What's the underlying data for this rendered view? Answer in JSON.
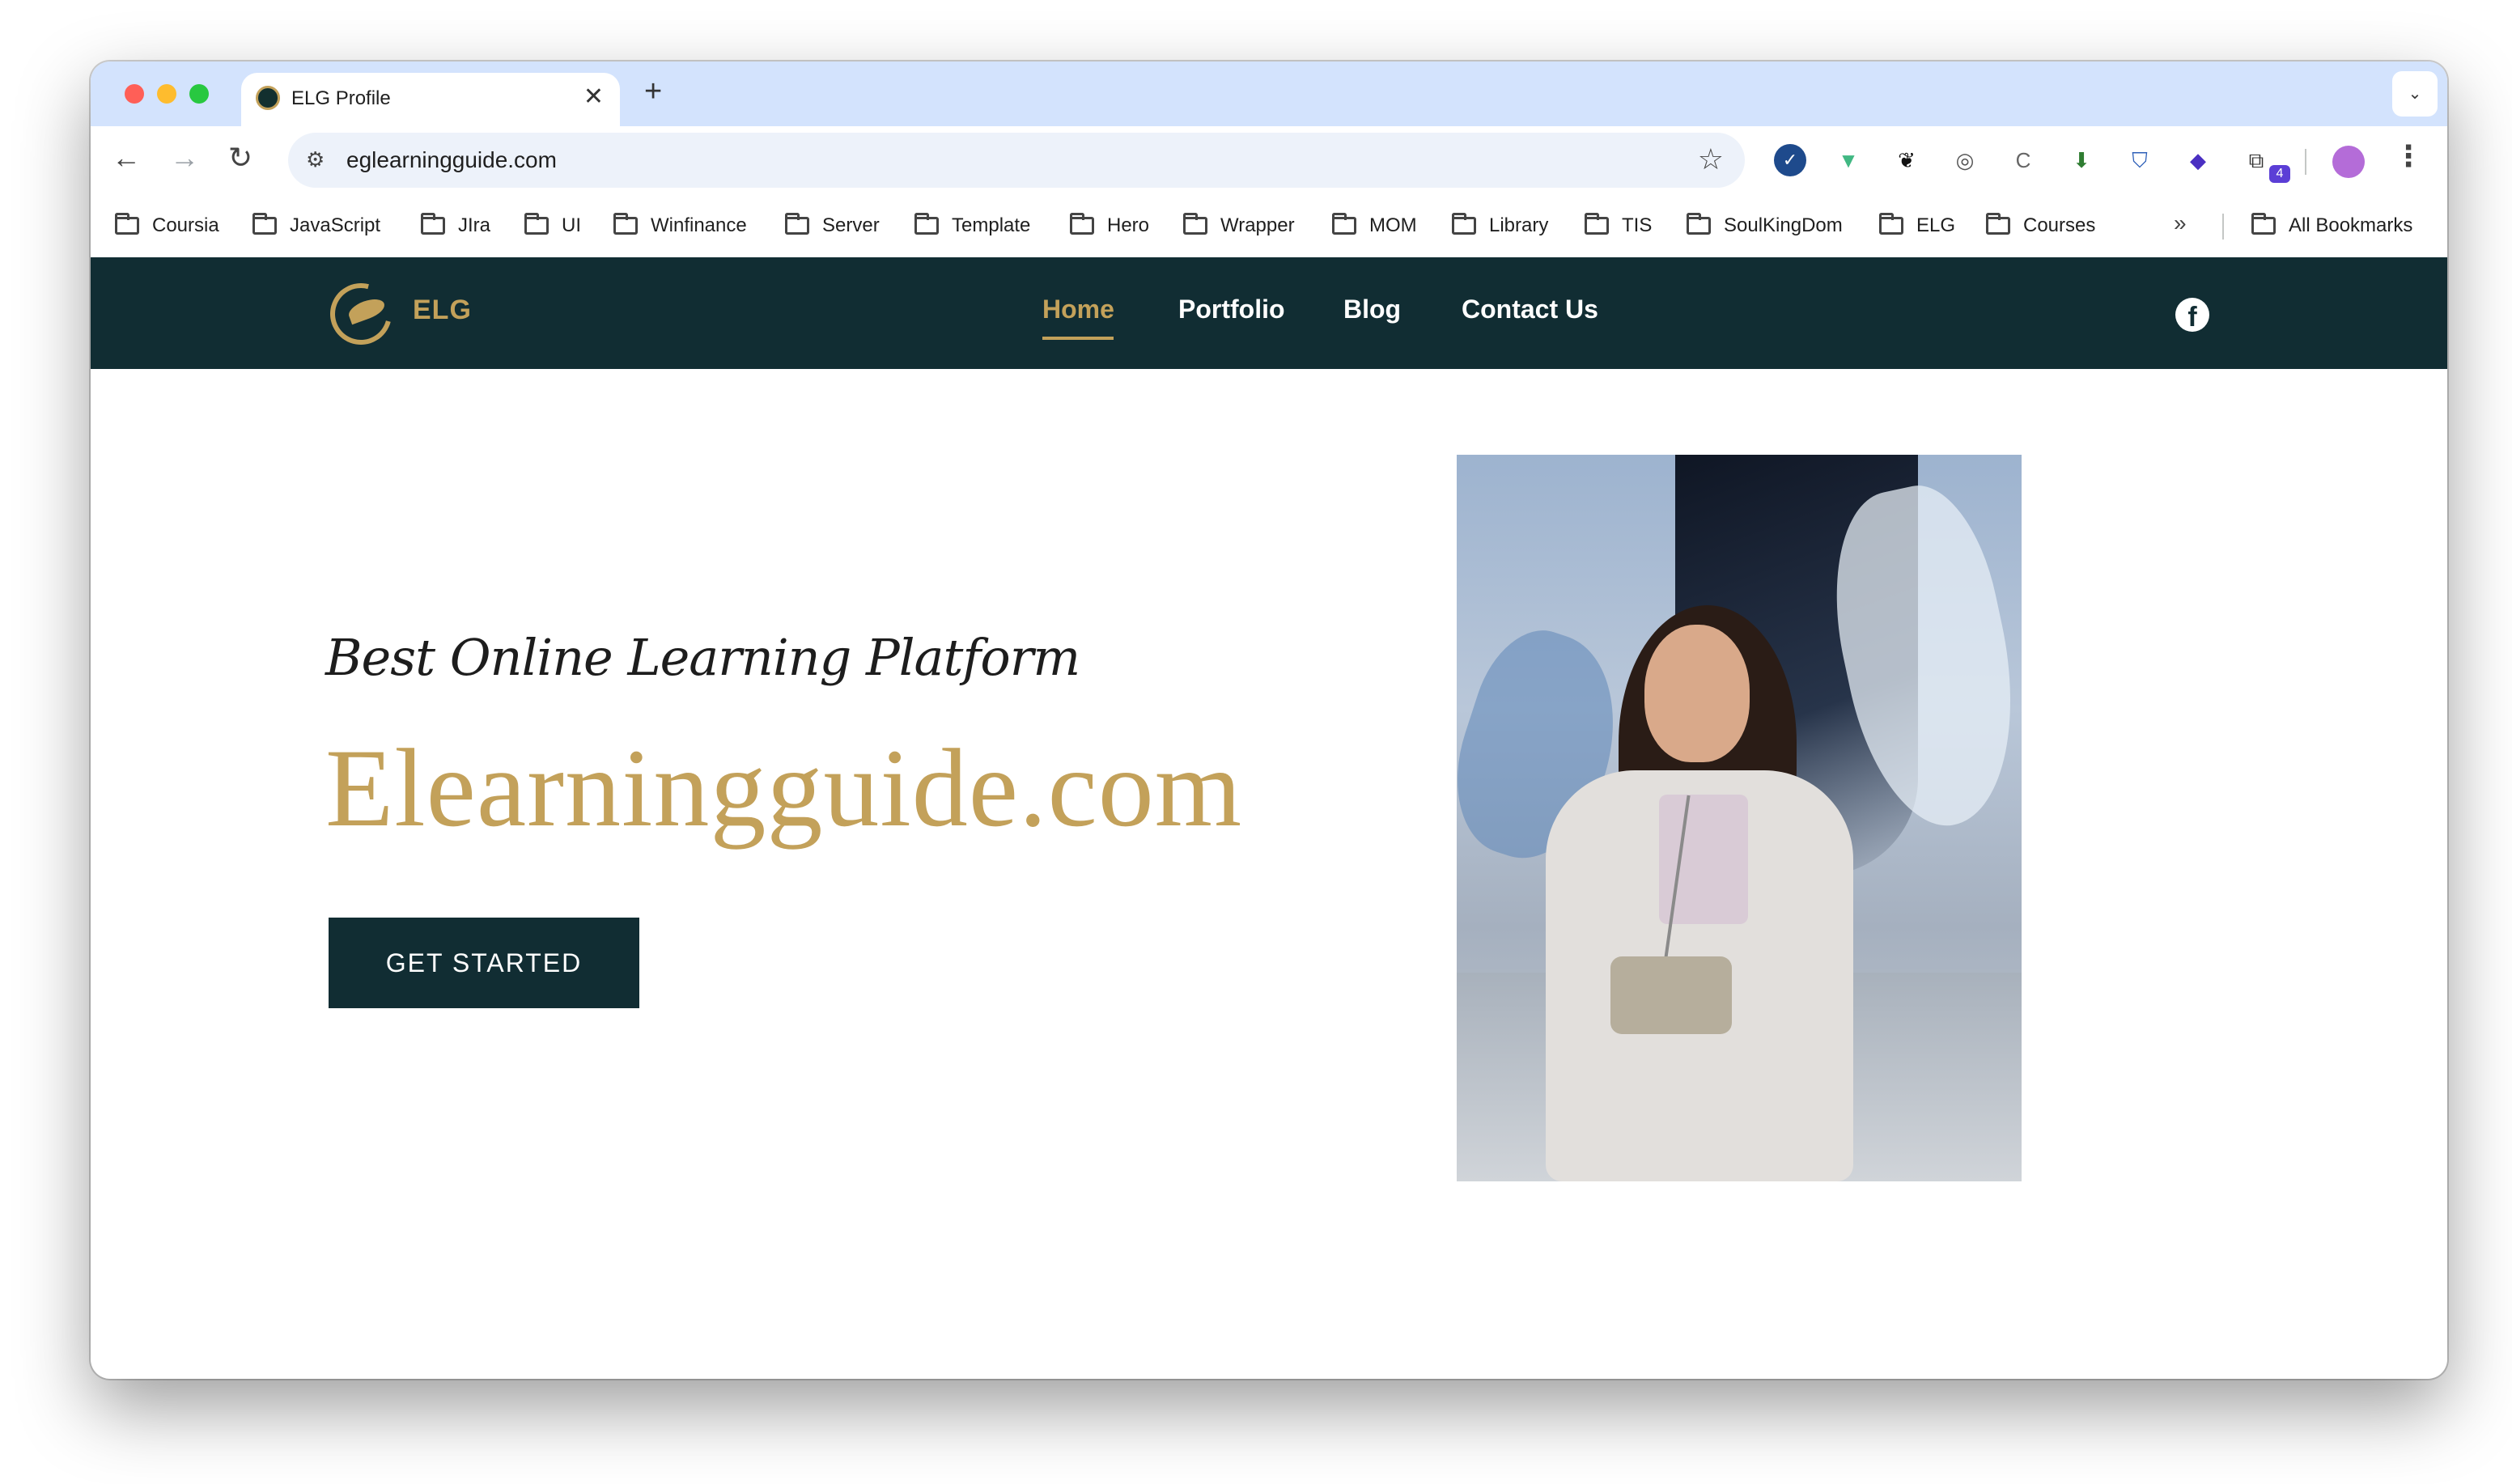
{
  "browser": {
    "tab": {
      "title": "ELG Profile",
      "close": "✕"
    },
    "new_tab": "+",
    "tab_search": "⌄",
    "nav": {
      "back": "←",
      "forward": "→",
      "reload": "↻"
    },
    "site_info_icon": "⚙",
    "url": "eglearningguide.com",
    "star": "☆",
    "extensions": [
      {
        "icon": "check-circle-icon",
        "glyph": "✓",
        "color": "#1e4a8c"
      },
      {
        "icon": "vue-icon",
        "glyph": "▼",
        "color": "#41b883"
      },
      {
        "icon": "rocket-icon",
        "glyph": "❦",
        "color": "#111111"
      },
      {
        "icon": "code-circle-icon",
        "glyph": "◎",
        "color": "#555555"
      },
      {
        "icon": "c-extension-icon",
        "glyph": "C",
        "color": "#666666"
      },
      {
        "icon": "download-arrow-icon",
        "glyph": "⬇",
        "color": "#2f7d32"
      },
      {
        "icon": "shield-icon",
        "glyph": "⛉",
        "color": "#2d5fb8"
      },
      {
        "icon": "puzzle-badge-icon",
        "glyph": "◆",
        "color": "#4a2fc2"
      },
      {
        "icon": "extensions-puzzle-icon",
        "glyph": "⧉",
        "color": "#333333"
      }
    ],
    "ext_badge": "4",
    "menu": "⋮",
    "bookmarks": [
      "Coursia",
      "JavaScript",
      "JIra",
      "UI",
      "Winfinance",
      "Server",
      "Template",
      "Hero",
      "Wrapper",
      "MOM",
      "Library",
      "TIS",
      "SoulKingDom",
      "ELG",
      "Courses"
    ],
    "bookmarks_more": "»",
    "all_bookmarks": "All Bookmarks"
  },
  "site": {
    "logo_text": "ELG",
    "nav": [
      {
        "label": "Home",
        "active": true
      },
      {
        "label": "Portfolio",
        "active": false
      },
      {
        "label": "Blog",
        "active": false
      },
      {
        "label": "Contact Us",
        "active": false
      }
    ],
    "facebook_glyph": "f",
    "hero": {
      "tagline": "Best Online Learning Platform",
      "title": "Elearningguide.com",
      "cta": "GET STARTED"
    },
    "colors": {
      "dark": "#112d33",
      "gold": "#c3a15a"
    }
  }
}
